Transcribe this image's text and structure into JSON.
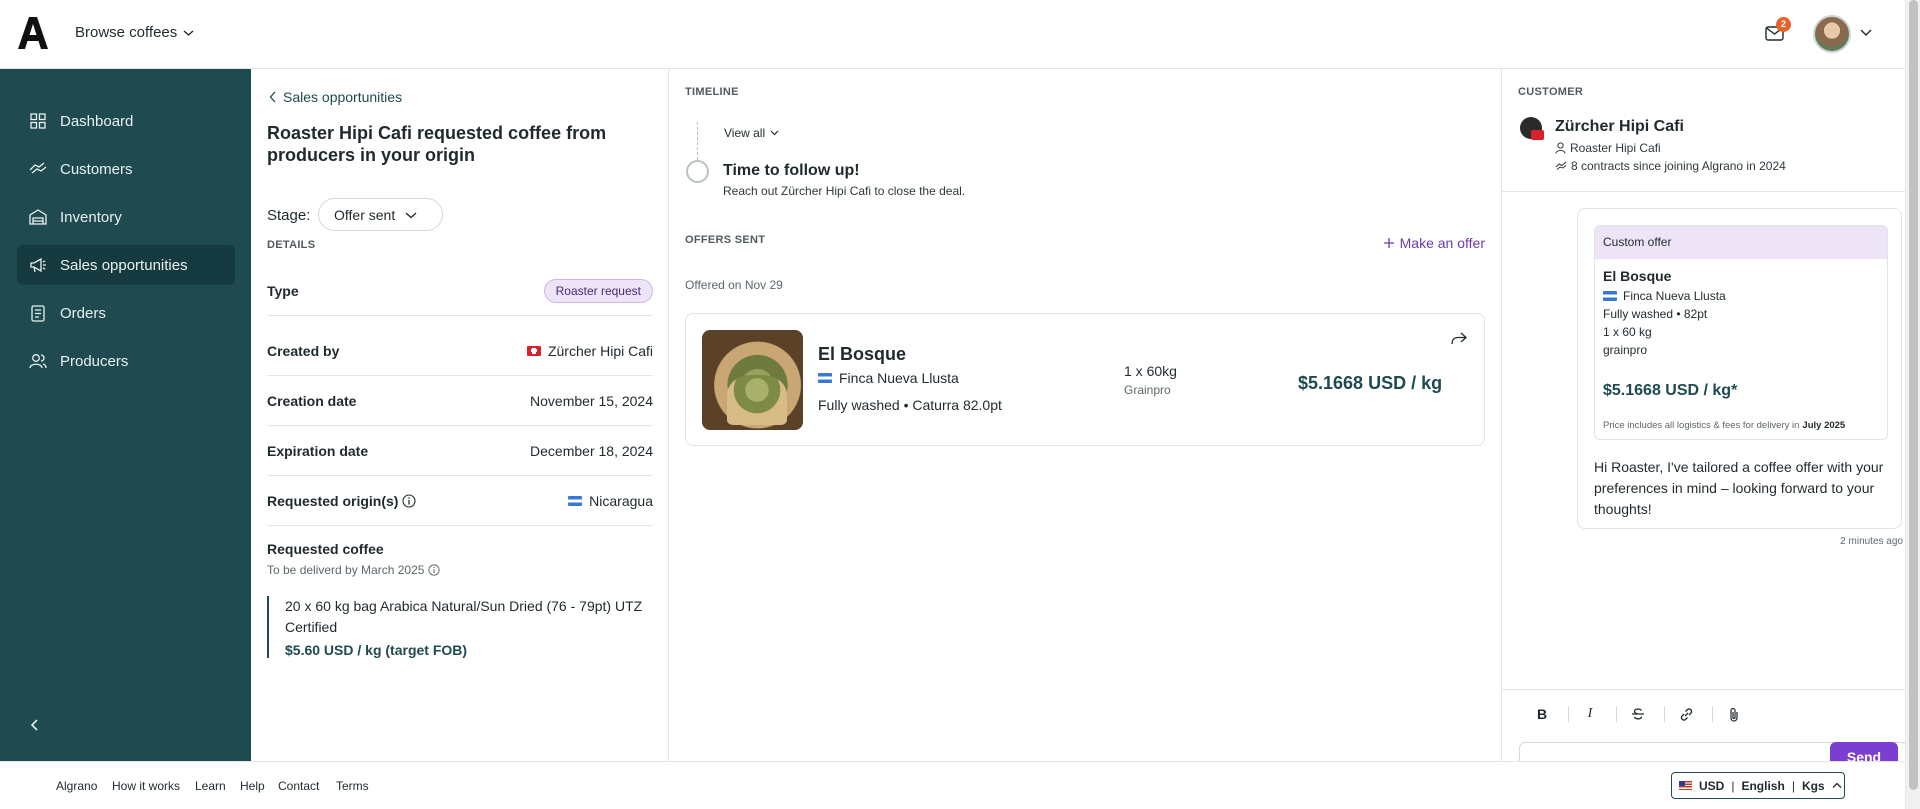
{
  "header": {
    "browse_label": "Browse coffees",
    "notification_count": "2"
  },
  "sidebar": {
    "items": [
      {
        "label": "Dashboard",
        "icon": "dashboard-icon"
      },
      {
        "label": "Customers",
        "icon": "handshake-icon"
      },
      {
        "label": "Inventory",
        "icon": "warehouse-icon"
      },
      {
        "label": "Sales opportunities",
        "icon": "megaphone-icon",
        "active": true
      },
      {
        "label": "Orders",
        "icon": "receipt-icon"
      },
      {
        "label": "Producers",
        "icon": "users-icon"
      }
    ]
  },
  "details": {
    "back_label": "Sales opportunities",
    "title": "Roaster Hipi Cafi requested coffee from producers in your origin",
    "stage_label": "Stage:",
    "stage_value": "Offer sent",
    "section_heading": "DETAILS",
    "rows": {
      "type": {
        "key": "Type",
        "value": "Roaster request"
      },
      "created_by": {
        "key": "Created by",
        "value": "Zürcher Hipi Cafi"
      },
      "creation_date": {
        "key": "Creation date",
        "value": "November 15, 2024"
      },
      "expiration_date": {
        "key": "Expiration date",
        "value": "December 18, 2024"
      },
      "origin": {
        "key": "Requested origin(s)",
        "value": "Nicaragua"
      }
    },
    "requested_coffee": {
      "title": "Requested coffee",
      "subtitle": "To be deliverd by March 2025",
      "description": "20 x 60 kg bag Arabica Natural/Sun Dried (76 - 79pt) UTZ Certified",
      "price": "$5.60 USD / kg (target FOB)"
    }
  },
  "timeline": {
    "label": "TIMELINE",
    "view_all": "View all",
    "event_title": "Time to follow up!",
    "event_sub": "Reach out Zürcher Hipi Cafi to close the deal."
  },
  "offers": {
    "label": "OFFERS SENT",
    "make_offer": "Make an offer",
    "offered_on": "Offered on Nov 29",
    "card": {
      "name": "El Bosque",
      "farm": "Finca Nueva Llusta",
      "process": "Fully washed • Caturra 82.0pt",
      "quantity": "1 x 60kg",
      "packaging": "Grainpro",
      "price": "$5.1668 USD / kg"
    }
  },
  "customer": {
    "label": "CUSTOMER",
    "name": "Zürcher Hipi Cafi",
    "contact": "Roaster Hipi Cafi",
    "contracts": "8 contracts since joining Algrano in 2024"
  },
  "message": {
    "offer_header": "Custom offer",
    "offer_name": "El Bosque",
    "offer_farm": "Finca Nueva Llusta",
    "offer_process": "Fully washed • 82pt",
    "offer_qty": "1 x 60 kg",
    "offer_pack": "grainpro",
    "offer_price": "$5.1668 USD / kg*",
    "offer_note_prefix": "Price includes all logistics & fees for delivery in",
    "offer_note_month": "July 2025",
    "text": "Hi Roaster, I've tailored a coffee offer with your preferences in mind – looking forward to your thoughts!",
    "time": "2 minutes ago"
  },
  "composer": {
    "bold": "B",
    "italic": "I",
    "send_label": "Send"
  },
  "footer": {
    "links": [
      "Algrano",
      "How it works",
      "Learn",
      "Help",
      "Contact",
      "Terms"
    ],
    "currency": "USD",
    "language": "English",
    "unit": "Kgs"
  },
  "colors": {
    "sidebar": "#1e4a50",
    "accent": "#7a3fd0",
    "badge": "#e8622a"
  }
}
